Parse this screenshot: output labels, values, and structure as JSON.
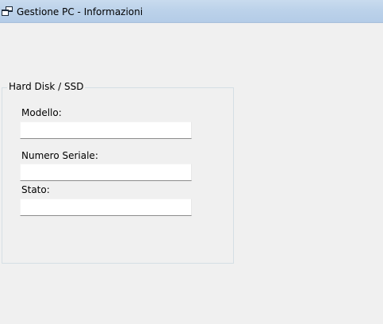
{
  "window": {
    "title": "Gestione PC - Informazioni",
    "icon": "app-window-icon"
  },
  "group": {
    "title": "Hard Disk / SSD",
    "fields": [
      {
        "label": "Modello:",
        "value": ""
      },
      {
        "label": "Numero Seriale:",
        "value": ""
      },
      {
        "label": "Stato:",
        "value": ""
      }
    ]
  }
}
